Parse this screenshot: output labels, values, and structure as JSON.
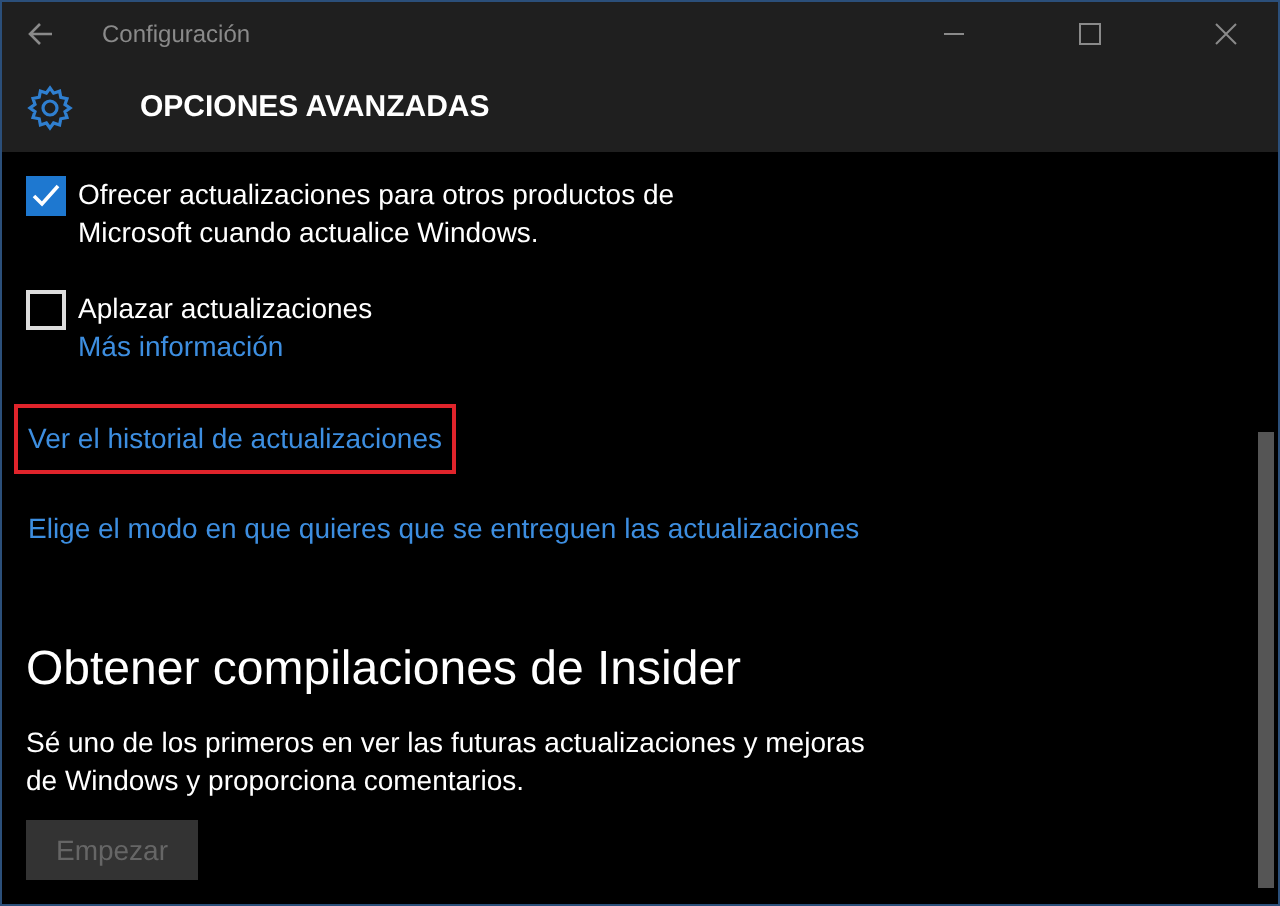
{
  "window": {
    "title": "Configuración"
  },
  "header": {
    "title": "OPCIONES AVANZADAS"
  },
  "options": [
    {
      "label": "Ofrecer actualizaciones para otros productos de Microsoft cuando actualice Windows.",
      "checked": true
    },
    {
      "label": "Aplazar actualizaciones",
      "checked": false,
      "link": "Más información"
    }
  ],
  "links": [
    {
      "label": "Ver el historial de actualizaciones",
      "highlighted": true
    },
    {
      "label": "Elige el modo en que quieres que se entreguen las actualizaciones",
      "highlighted": false
    }
  ],
  "insider": {
    "heading": "Obtener compilaciones de Insider",
    "description": "Sé uno de los primeros en ver las futuras actualizaciones y mejoras de Windows y proporciona comentarios.",
    "button": {
      "label": "Empezar",
      "disabled": true
    }
  }
}
